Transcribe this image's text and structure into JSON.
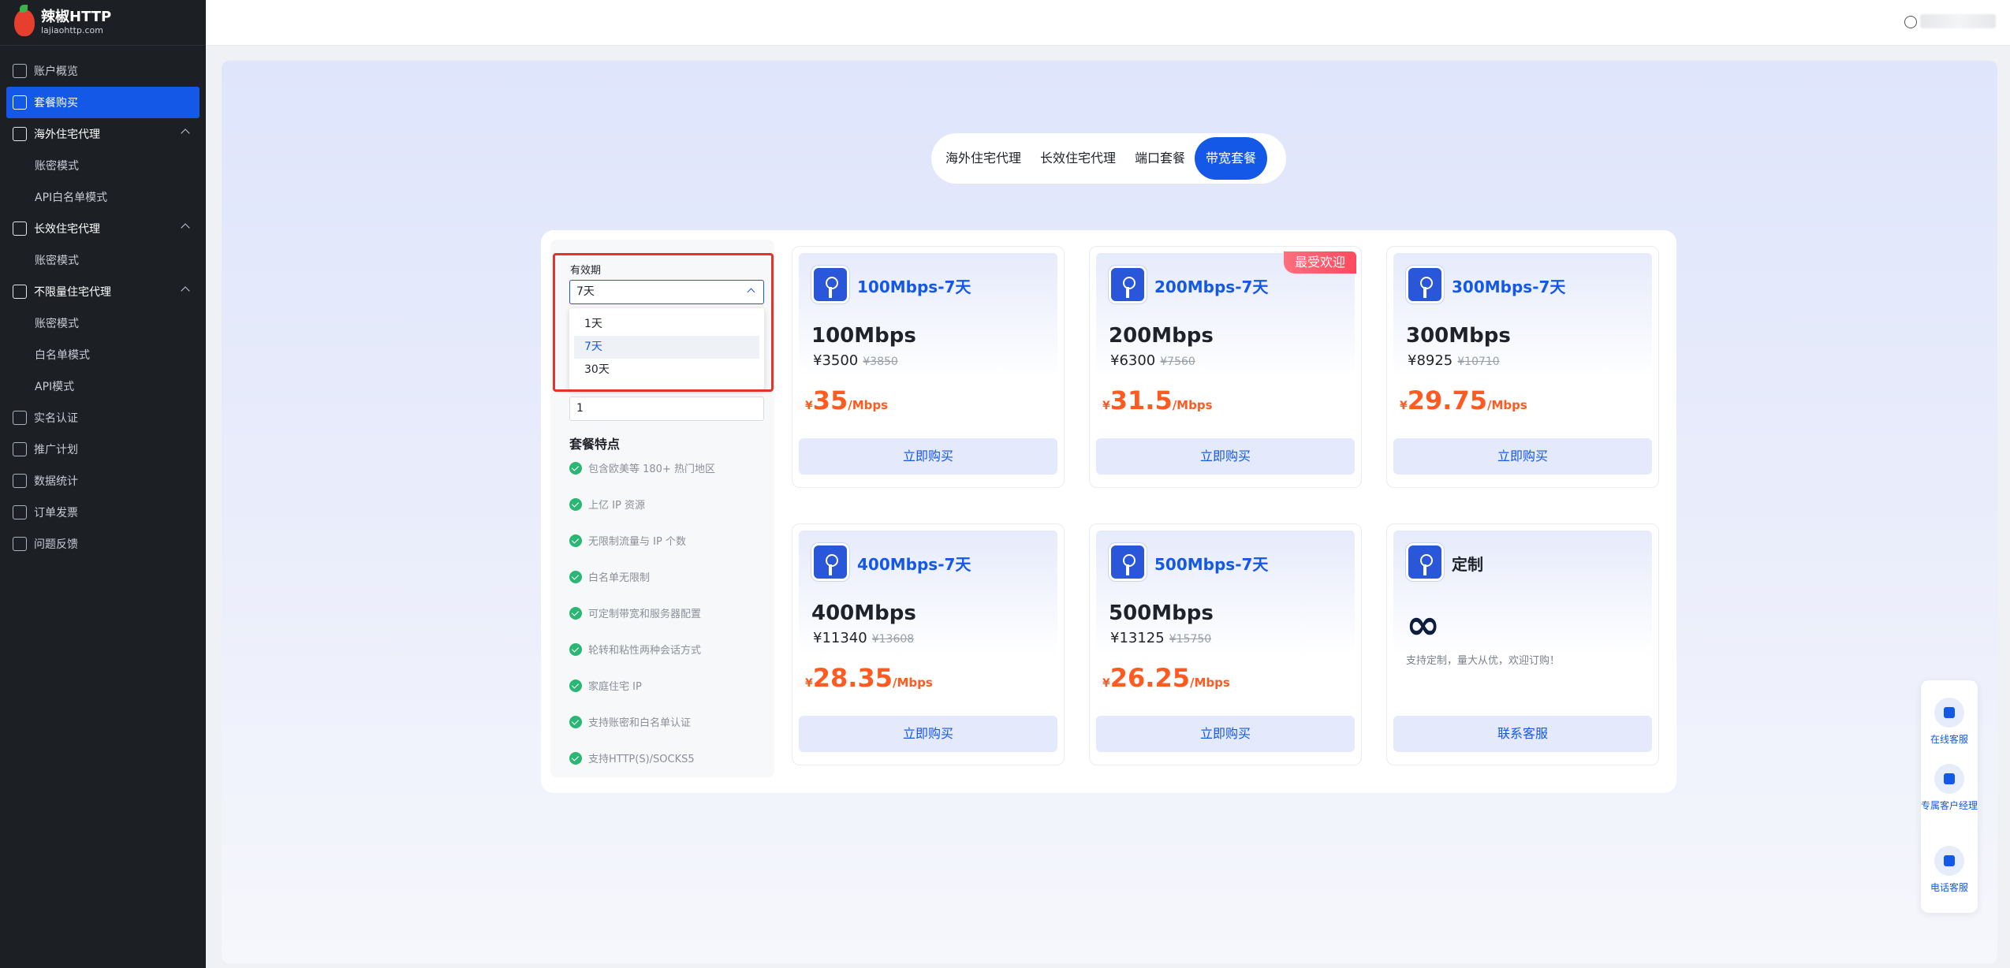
{
  "app": {
    "title": "辣椒HTTP",
    "subtitle": "lajiaohttp.com"
  },
  "sidebar": {
    "items": [
      {
        "label": "账户概览",
        "type": "item"
      },
      {
        "label": "套餐购买",
        "type": "active"
      },
      {
        "label": "海外住宅代理",
        "type": "group"
      },
      {
        "label": "账密模式",
        "type": "sub"
      },
      {
        "label": "API白名单模式",
        "type": "sub"
      },
      {
        "label": "长效住宅代理",
        "type": "group"
      },
      {
        "label": "账密模式",
        "type": "sub"
      },
      {
        "label": "不限量住宅代理",
        "type": "group"
      },
      {
        "label": "账密模式",
        "type": "sub"
      },
      {
        "label": "白名单模式",
        "type": "sub"
      },
      {
        "label": "API模式",
        "type": "sub"
      },
      {
        "label": "实名认证",
        "type": "item"
      },
      {
        "label": "推广计划",
        "type": "item"
      },
      {
        "label": "数据统计",
        "type": "item"
      },
      {
        "label": "订单发票",
        "type": "item"
      },
      {
        "label": "问题反馈",
        "type": "item"
      }
    ]
  },
  "tabs": [
    "海外住宅代理",
    "长效住宅代理",
    "端口套餐",
    "带宽套餐"
  ],
  "active_tab": "带宽套餐",
  "form": {
    "validity_label": "有效期",
    "validity_value": "7天",
    "options": [
      "1天",
      "7天",
      "30天"
    ],
    "selected_option": "7天",
    "quantity_value": "1"
  },
  "features": {
    "title": "套餐特点",
    "items": [
      "包含欧美等 180+ 热门地区",
      "上亿 IP 资源",
      "无限制流量与 IP 个数",
      "白名单无限制",
      "可定制带宽和服务器配置",
      "轮转和粘性两种会话方式",
      "家庭住宅 IP",
      "支持账密和白名单认证",
      "支持HTTP(S)/SOCKS5"
    ]
  },
  "plans": [
    {
      "name": "100Mbps-7天",
      "speed": "100Mbps",
      "price": "¥3500",
      "orig": "¥3850",
      "unit_symbol": "¥",
      "unit_price": "35",
      "unit_suffix": "/Mbps",
      "button": "立即购买"
    },
    {
      "name": "200Mbps-7天",
      "speed": "200Mbps",
      "price": "¥6300",
      "orig": "¥7560",
      "unit_symbol": "¥",
      "unit_price": "31.5",
      "unit_suffix": "/Mbps",
      "button": "立即购买",
      "badge": "最受欢迎"
    },
    {
      "name": "300Mbps-7天",
      "speed": "300Mbps",
      "price": "¥8925",
      "orig": "¥10710",
      "unit_symbol": "¥",
      "unit_price": "29.75",
      "unit_suffix": "/Mbps",
      "button": "立即购买"
    },
    {
      "name": "400Mbps-7天",
      "speed": "400Mbps",
      "price": "¥11340",
      "orig": "¥13608",
      "unit_symbol": "¥",
      "unit_price": "28.35",
      "unit_suffix": "/Mbps",
      "button": "立即购买"
    },
    {
      "name": "500Mbps-7天",
      "speed": "500Mbps",
      "price": "¥13125",
      "orig": "¥15750",
      "unit_symbol": "¥",
      "unit_price": "26.25",
      "unit_suffix": "/Mbps",
      "button": "立即购买"
    }
  ],
  "custom_plan": {
    "name": "定制",
    "symbol": "∞",
    "desc": "支持定制，量大从优，欢迎订购！",
    "button": "联系客服"
  },
  "float_menu": [
    "在线客服",
    "专属客户经理",
    "电话客服"
  ],
  "colors": {
    "accent": "#1458e8",
    "sidebar_bg": "#1c1f24",
    "price_orange": "#ff5a1f",
    "badge_red": "#ff4a5e",
    "highlight_border": "#e2342a"
  }
}
